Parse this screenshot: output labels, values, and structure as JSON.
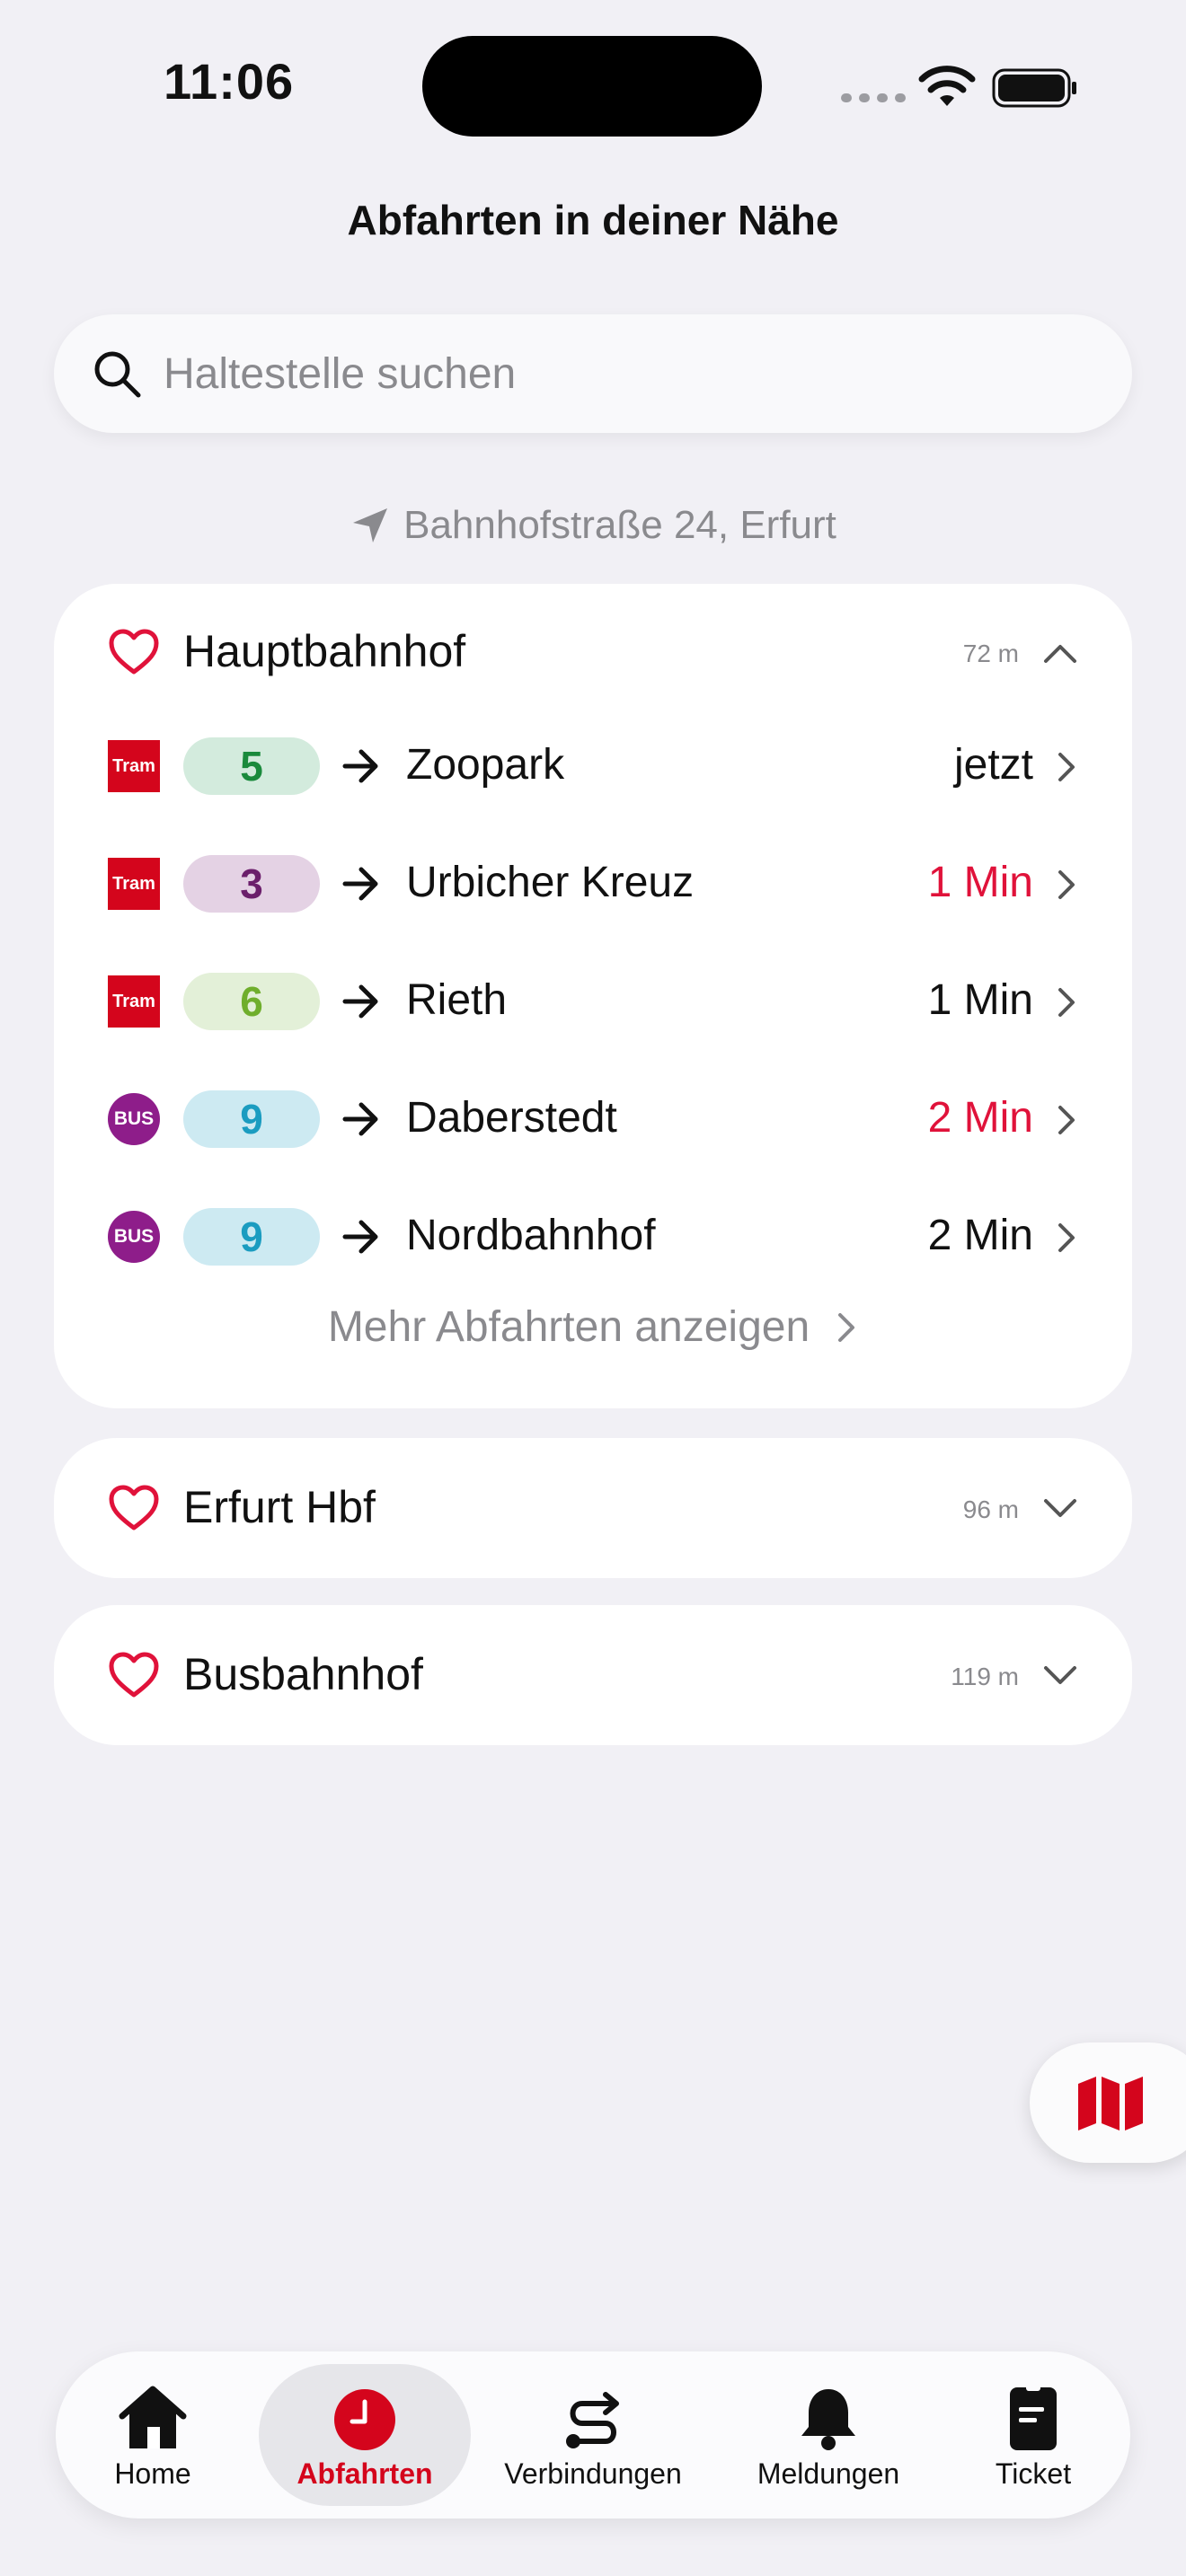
{
  "status": {
    "time": "11:06"
  },
  "title": "Abfahrten in deiner Nähe",
  "search": {
    "placeholder": "Haltestelle suchen",
    "value": ""
  },
  "location": "Bahnhofstraße 24, Erfurt",
  "colors": {
    "accent": "#d4051c",
    "late": "#e0123a",
    "bus": "#8e1d8a",
    "muted": "#8a8a8e"
  },
  "stops": [
    {
      "name": "Hauptbahnhof",
      "distance": "72 m",
      "expanded": true,
      "departures": [
        {
          "mode": "Tram",
          "line": "5",
          "line_color": "#1a8a3c",
          "line_bg": "#d3ebdd",
          "destination": "Zoopark",
          "time": "jetzt",
          "late": false
        },
        {
          "mode": "Tram",
          "line": "3",
          "line_color": "#6b1f6b",
          "line_bg": "#e4d2e4",
          "destination": "Urbicher Kreuz",
          "time": "1 Min",
          "late": true
        },
        {
          "mode": "Tram",
          "line": "6",
          "line_color": "#6fae2c",
          "line_bg": "#e3f0d8",
          "destination": "Rieth",
          "time": "1 Min",
          "late": false
        },
        {
          "mode": "BUS",
          "line": "9",
          "line_color": "#1b9cc0",
          "line_bg": "#cdeaf2",
          "destination": "Daberstedt",
          "time": "2 Min",
          "late": true
        },
        {
          "mode": "BUS",
          "line": "9",
          "line_color": "#1b9cc0",
          "line_bg": "#cdeaf2",
          "destination": "Nordbahnhof",
          "time": "2 Min",
          "late": false
        }
      ],
      "more_label": "Mehr Abfahrten anzeigen"
    },
    {
      "name": "Erfurt Hbf",
      "distance": "96 m",
      "expanded": false
    },
    {
      "name": "Busbahnhof",
      "distance": "119 m",
      "expanded": false
    }
  ],
  "map_button_icon": "map-icon",
  "tabs": [
    {
      "label": "Home",
      "icon": "home-icon",
      "active": false
    },
    {
      "label": "Abfahrten",
      "icon": "clock-icon",
      "active": true
    },
    {
      "label": "Verbindungen",
      "icon": "route-icon",
      "active": false
    },
    {
      "label": "Meldungen",
      "icon": "bell-icon",
      "active": false
    },
    {
      "label": "Ticket",
      "icon": "ticket-icon",
      "active": false
    }
  ]
}
